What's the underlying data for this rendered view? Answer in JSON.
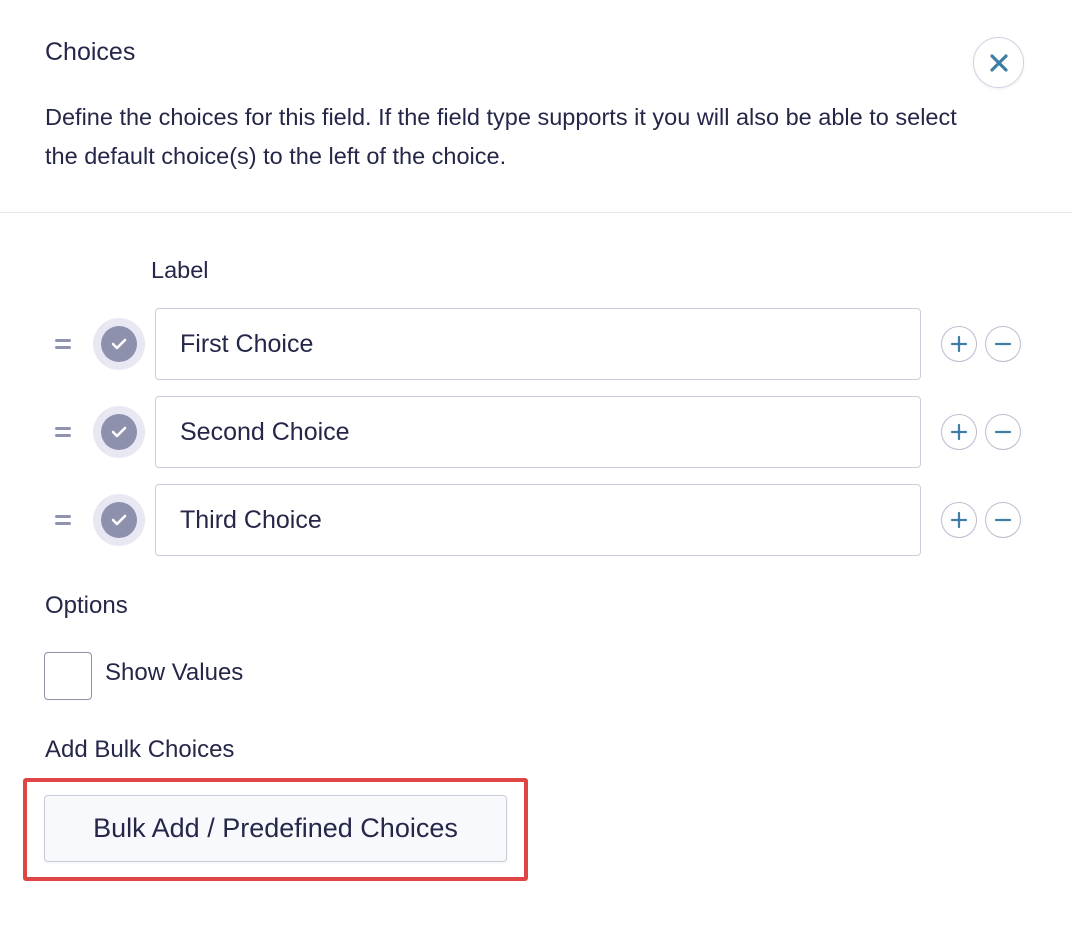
{
  "header": {
    "title": "Choices",
    "description": "Define the choices for this field. If the field type supports it you will also be able to select the default choice(s) to the left of the choice."
  },
  "choices": {
    "column_label": "Label",
    "items": [
      {
        "value": "First Choice",
        "is_default": true
      },
      {
        "value": "Second Choice",
        "is_default": true
      },
      {
        "value": "Third Choice",
        "is_default": true
      }
    ]
  },
  "options": {
    "heading": "Options",
    "show_values_label": "Show Values",
    "show_values_checked": false
  },
  "bulk": {
    "heading": "Add Bulk Choices",
    "button_label": "Bulk Add / Predefined Choices"
  },
  "icons": {
    "close": "close-icon",
    "drag": "drag-handle-icon",
    "default": "check-circle-icon",
    "add": "plus-icon",
    "remove": "minus-icon"
  },
  "colors": {
    "text": "#242748",
    "accent": "#3e7da6",
    "highlight": "#e04545"
  }
}
